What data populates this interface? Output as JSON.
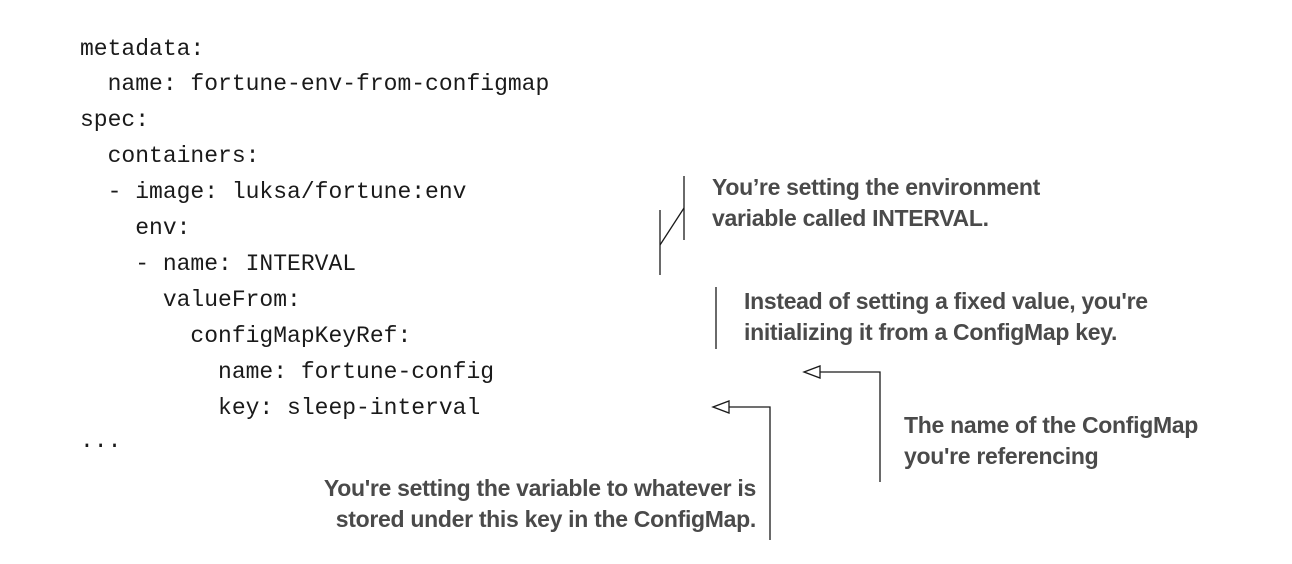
{
  "code_lines": [
    "metadata:",
    "  name: fortune-env-from-configmap",
    "spec:",
    "  containers:",
    "  - image: luksa/fortune:env",
    "    env:",
    "    - name: INTERVAL",
    "      valueFrom:",
    "        configMapKeyRef:",
    "          name: fortune-config",
    "          key: sleep-interval",
    "..."
  ],
  "annotations": {
    "env_var": {
      "line1": "You’re setting the environment",
      "line2": "variable called INTERVAL."
    },
    "value_from": {
      "line1": "Instead of setting a fixed value, you're",
      "line2": "initializing it from a ConfigMap key."
    },
    "configmap_name": {
      "line1": "The name of the ConfigMap",
      "line2": "you're referencing"
    },
    "configmap_key": {
      "line1": "You're setting the variable to whatever is",
      "line2": "stored under this key in the ConfigMap."
    }
  }
}
